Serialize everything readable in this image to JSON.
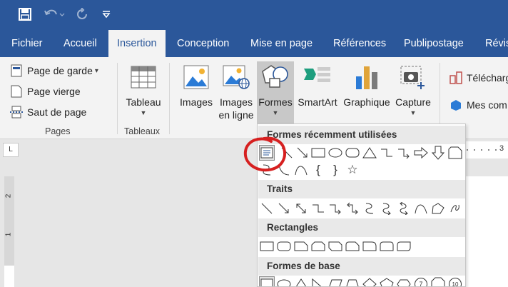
{
  "tabs": [
    {
      "label": "Fichier"
    },
    {
      "label": "Accueil"
    },
    {
      "label": "Insertion"
    },
    {
      "label": "Conception"
    },
    {
      "label": "Mise en page"
    },
    {
      "label": "Références"
    },
    {
      "label": "Publipostage"
    },
    {
      "label": "Révis"
    }
  ],
  "pages_group": {
    "label": "Pages",
    "items": [
      {
        "label": "Page de garde",
        "icon": "cover-page-icon"
      },
      {
        "label": "Page vierge",
        "icon": "blank-page-icon"
      },
      {
        "label": "Saut de page",
        "icon": "page-break-icon"
      }
    ],
    "dropdown_caret": "▾"
  },
  "tables_group": {
    "label": "Tableaux",
    "button": "Tableau"
  },
  "illustrations": {
    "images": "Images",
    "online_images_1": "Images",
    "online_images_2": "en ligne",
    "shapes": "Formes",
    "smartart": "SmartArt",
    "chart": "Graphique",
    "capture": "Capture"
  },
  "addins": {
    "telecharger": "Télécharg",
    "mes": "Mes com"
  },
  "ruler": {
    "corner": "L",
    "numbers": [
      "3"
    ],
    "vnumbers": [
      "2",
      "1"
    ]
  },
  "shapes_gallery": {
    "sections": [
      {
        "title": "Formes récemment utilisées"
      },
      {
        "title": "Traits"
      },
      {
        "title": "Rectangles"
      },
      {
        "title": "Formes de base"
      }
    ],
    "brace_open": "{",
    "brace_close": "}",
    "star": "☆",
    "n7": "7",
    "n10": "10"
  },
  "colors": {
    "brand": "#2b579a",
    "annotation": "#d62020"
  }
}
